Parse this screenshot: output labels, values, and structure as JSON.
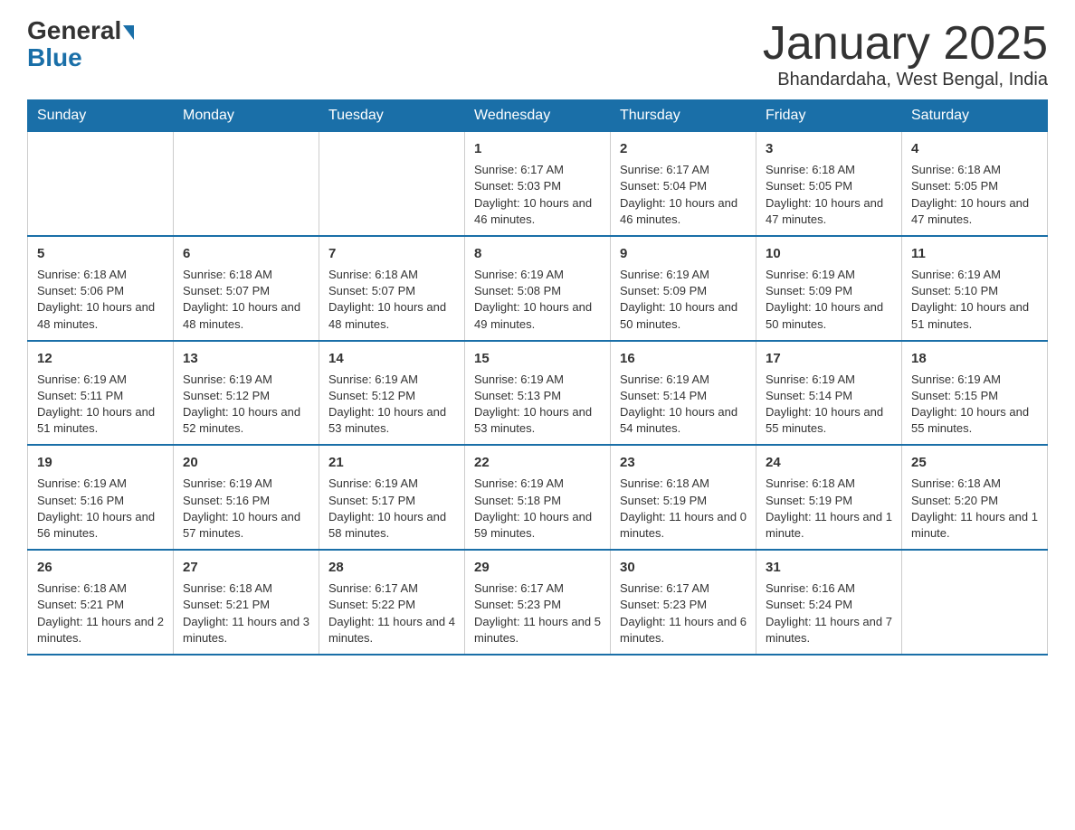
{
  "header": {
    "logo": {
      "general": "General",
      "blue": "Blue",
      "arrow": "▼"
    },
    "title": "January 2025",
    "location": "Bhandardaha, West Bengal, India"
  },
  "days_of_week": [
    "Sunday",
    "Monday",
    "Tuesday",
    "Wednesday",
    "Thursday",
    "Friday",
    "Saturday"
  ],
  "weeks": [
    [
      {
        "day": "",
        "info": ""
      },
      {
        "day": "",
        "info": ""
      },
      {
        "day": "",
        "info": ""
      },
      {
        "day": "1",
        "info": "Sunrise: 6:17 AM\nSunset: 5:03 PM\nDaylight: 10 hours and 46 minutes."
      },
      {
        "day": "2",
        "info": "Sunrise: 6:17 AM\nSunset: 5:04 PM\nDaylight: 10 hours and 46 minutes."
      },
      {
        "day": "3",
        "info": "Sunrise: 6:18 AM\nSunset: 5:05 PM\nDaylight: 10 hours and 47 minutes."
      },
      {
        "day": "4",
        "info": "Sunrise: 6:18 AM\nSunset: 5:05 PM\nDaylight: 10 hours and 47 minutes."
      }
    ],
    [
      {
        "day": "5",
        "info": "Sunrise: 6:18 AM\nSunset: 5:06 PM\nDaylight: 10 hours and 48 minutes."
      },
      {
        "day": "6",
        "info": "Sunrise: 6:18 AM\nSunset: 5:07 PM\nDaylight: 10 hours and 48 minutes."
      },
      {
        "day": "7",
        "info": "Sunrise: 6:18 AM\nSunset: 5:07 PM\nDaylight: 10 hours and 48 minutes."
      },
      {
        "day": "8",
        "info": "Sunrise: 6:19 AM\nSunset: 5:08 PM\nDaylight: 10 hours and 49 minutes."
      },
      {
        "day": "9",
        "info": "Sunrise: 6:19 AM\nSunset: 5:09 PM\nDaylight: 10 hours and 50 minutes."
      },
      {
        "day": "10",
        "info": "Sunrise: 6:19 AM\nSunset: 5:09 PM\nDaylight: 10 hours and 50 minutes."
      },
      {
        "day": "11",
        "info": "Sunrise: 6:19 AM\nSunset: 5:10 PM\nDaylight: 10 hours and 51 minutes."
      }
    ],
    [
      {
        "day": "12",
        "info": "Sunrise: 6:19 AM\nSunset: 5:11 PM\nDaylight: 10 hours and 51 minutes."
      },
      {
        "day": "13",
        "info": "Sunrise: 6:19 AM\nSunset: 5:12 PM\nDaylight: 10 hours and 52 minutes."
      },
      {
        "day": "14",
        "info": "Sunrise: 6:19 AM\nSunset: 5:12 PM\nDaylight: 10 hours and 53 minutes."
      },
      {
        "day": "15",
        "info": "Sunrise: 6:19 AM\nSunset: 5:13 PM\nDaylight: 10 hours and 53 minutes."
      },
      {
        "day": "16",
        "info": "Sunrise: 6:19 AM\nSunset: 5:14 PM\nDaylight: 10 hours and 54 minutes."
      },
      {
        "day": "17",
        "info": "Sunrise: 6:19 AM\nSunset: 5:14 PM\nDaylight: 10 hours and 55 minutes."
      },
      {
        "day": "18",
        "info": "Sunrise: 6:19 AM\nSunset: 5:15 PM\nDaylight: 10 hours and 55 minutes."
      }
    ],
    [
      {
        "day": "19",
        "info": "Sunrise: 6:19 AM\nSunset: 5:16 PM\nDaylight: 10 hours and 56 minutes."
      },
      {
        "day": "20",
        "info": "Sunrise: 6:19 AM\nSunset: 5:16 PM\nDaylight: 10 hours and 57 minutes."
      },
      {
        "day": "21",
        "info": "Sunrise: 6:19 AM\nSunset: 5:17 PM\nDaylight: 10 hours and 58 minutes."
      },
      {
        "day": "22",
        "info": "Sunrise: 6:19 AM\nSunset: 5:18 PM\nDaylight: 10 hours and 59 minutes."
      },
      {
        "day": "23",
        "info": "Sunrise: 6:18 AM\nSunset: 5:19 PM\nDaylight: 11 hours and 0 minutes."
      },
      {
        "day": "24",
        "info": "Sunrise: 6:18 AM\nSunset: 5:19 PM\nDaylight: 11 hours and 1 minute."
      },
      {
        "day": "25",
        "info": "Sunrise: 6:18 AM\nSunset: 5:20 PM\nDaylight: 11 hours and 1 minute."
      }
    ],
    [
      {
        "day": "26",
        "info": "Sunrise: 6:18 AM\nSunset: 5:21 PM\nDaylight: 11 hours and 2 minutes."
      },
      {
        "day": "27",
        "info": "Sunrise: 6:18 AM\nSunset: 5:21 PM\nDaylight: 11 hours and 3 minutes."
      },
      {
        "day": "28",
        "info": "Sunrise: 6:17 AM\nSunset: 5:22 PM\nDaylight: 11 hours and 4 minutes."
      },
      {
        "day": "29",
        "info": "Sunrise: 6:17 AM\nSunset: 5:23 PM\nDaylight: 11 hours and 5 minutes."
      },
      {
        "day": "30",
        "info": "Sunrise: 6:17 AM\nSunset: 5:23 PM\nDaylight: 11 hours and 6 minutes."
      },
      {
        "day": "31",
        "info": "Sunrise: 6:16 AM\nSunset: 5:24 PM\nDaylight: 11 hours and 7 minutes."
      },
      {
        "day": "",
        "info": ""
      }
    ]
  ]
}
